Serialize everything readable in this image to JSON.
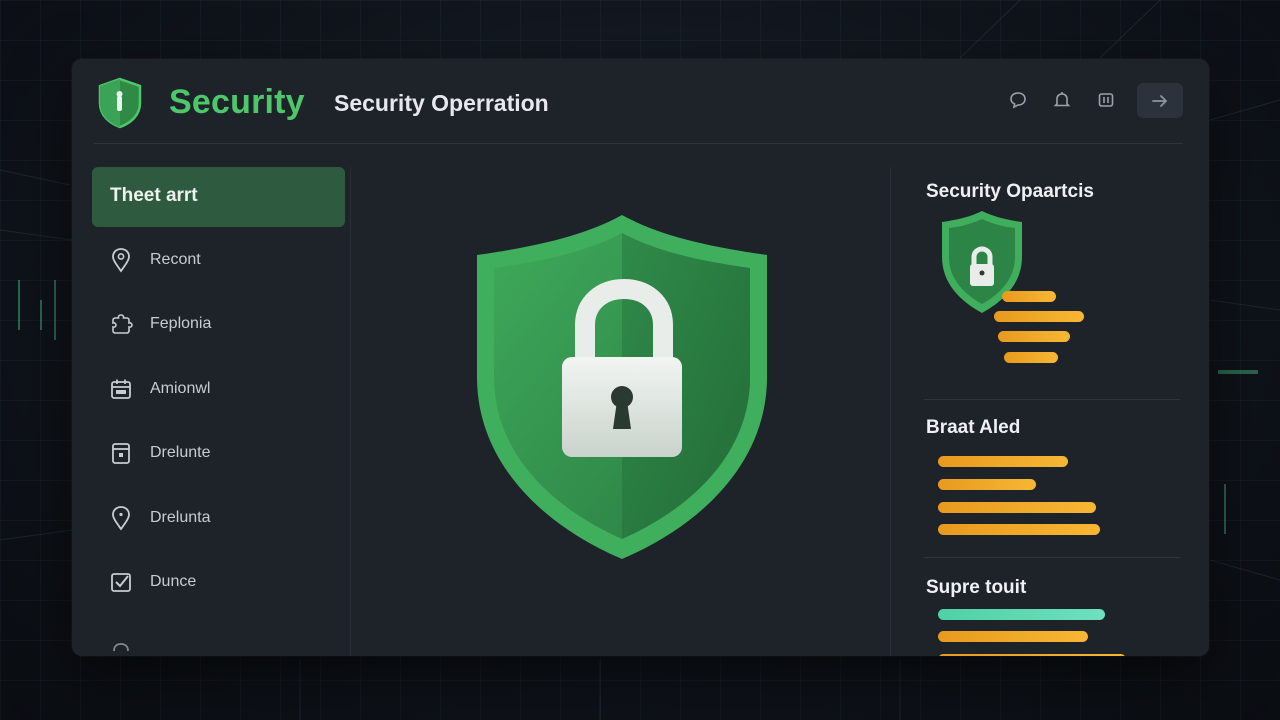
{
  "header": {
    "brand": "Security",
    "title": "Security Operration"
  },
  "sidebar": {
    "active": "Theet arrt",
    "items": [
      {
        "label": "Recont",
        "icon": "map-pin-icon"
      },
      {
        "label": "Feplonia",
        "icon": "puzzle-icon"
      },
      {
        "label": "Amionwl",
        "icon": "calendar-icon"
      },
      {
        "label": "Drelunte",
        "icon": "document-icon"
      },
      {
        "label": "Drelunta",
        "icon": "location-icon"
      },
      {
        "label": "Dunce",
        "icon": "checkbox-icon"
      }
    ]
  },
  "right_panel": {
    "sections": [
      {
        "title": "Security Opaartcis"
      },
      {
        "title": "Braat Aled"
      },
      {
        "title": "Supre touit"
      }
    ]
  },
  "colors": {
    "accent_green": "#4cc76a",
    "active_bg": "#2e5b3f",
    "bar_orange": "#f2a825",
    "bar_teal": "#5ad8b0"
  }
}
